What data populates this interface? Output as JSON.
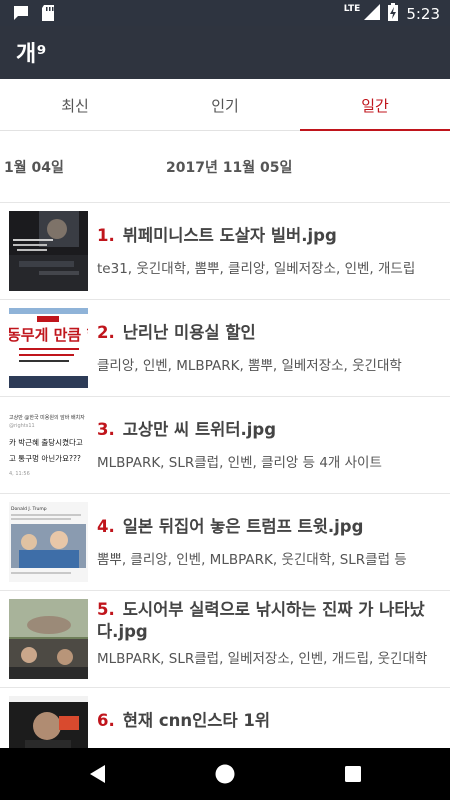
{
  "status_bar": {
    "network": "LTE",
    "time": "5:23",
    "icons": [
      "chat-icon",
      "sd-card-icon",
      "signal-icon",
      "battery-charging-icon"
    ]
  },
  "app": {
    "title": "개⁹"
  },
  "tabs": [
    {
      "label": "최신",
      "active": false
    },
    {
      "label": "인기",
      "active": false
    },
    {
      "label": "일간",
      "active": true
    }
  ],
  "dates": {
    "prev": "1월 04일",
    "current": "2017년 11월 05일"
  },
  "posts": [
    {
      "num": "1.",
      "title": "뷔페미니스트 도살자 빌버.jpg",
      "sources": "te31, 웃긴대학, 뽐뿌, 클리앙, 일베저장소, 인벤, 개드립"
    },
    {
      "num": "2.",
      "title": "난리난 미용실 할인",
      "sources": "클리앙, 인벤, MLBPARK, 뽐뿌, 일베저장소, 웃긴대학"
    },
    {
      "num": "3.",
      "title": "고상만 씨 트위터.jpg",
      "sources": "MLBPARK, SLR클럽, 인벤, 클리앙 등 4개 사이트"
    },
    {
      "num": "4.",
      "title": "일본 뒤집어 놓은 트럼프 트윗.jpg",
      "sources": "뽐뿌, 클리앙, 인벤, MLBPARK, 웃긴대학, SLR클럽 등"
    },
    {
      "num": "5.",
      "title": "도시어부 실력으로 낚시하는 진짜 가 나타났다.jpg",
      "sources": "MLBPARK, SLR클럽, 일베저장소, 인벤, 개드립, 웃긴대학"
    },
    {
      "num": "6.",
      "title": "현재 cnn인스타 1위",
      "sources": ""
    }
  ],
  "thumbnail_text": {
    "post2": "동무게 만큼 할",
    "post3": [
      "고상만 @한국 미용원의 앞바 배치자",
      "@rights11",
      "카 박근혜 출당시켰다고",
      "고 통구멍 아닌가요???",
      "4, 11:56"
    ],
    "post4": "Donald J. Trump"
  },
  "colors": {
    "accent": "#c0151c",
    "app_bar": "#2f343f",
    "status_bar": "#2e3440"
  }
}
